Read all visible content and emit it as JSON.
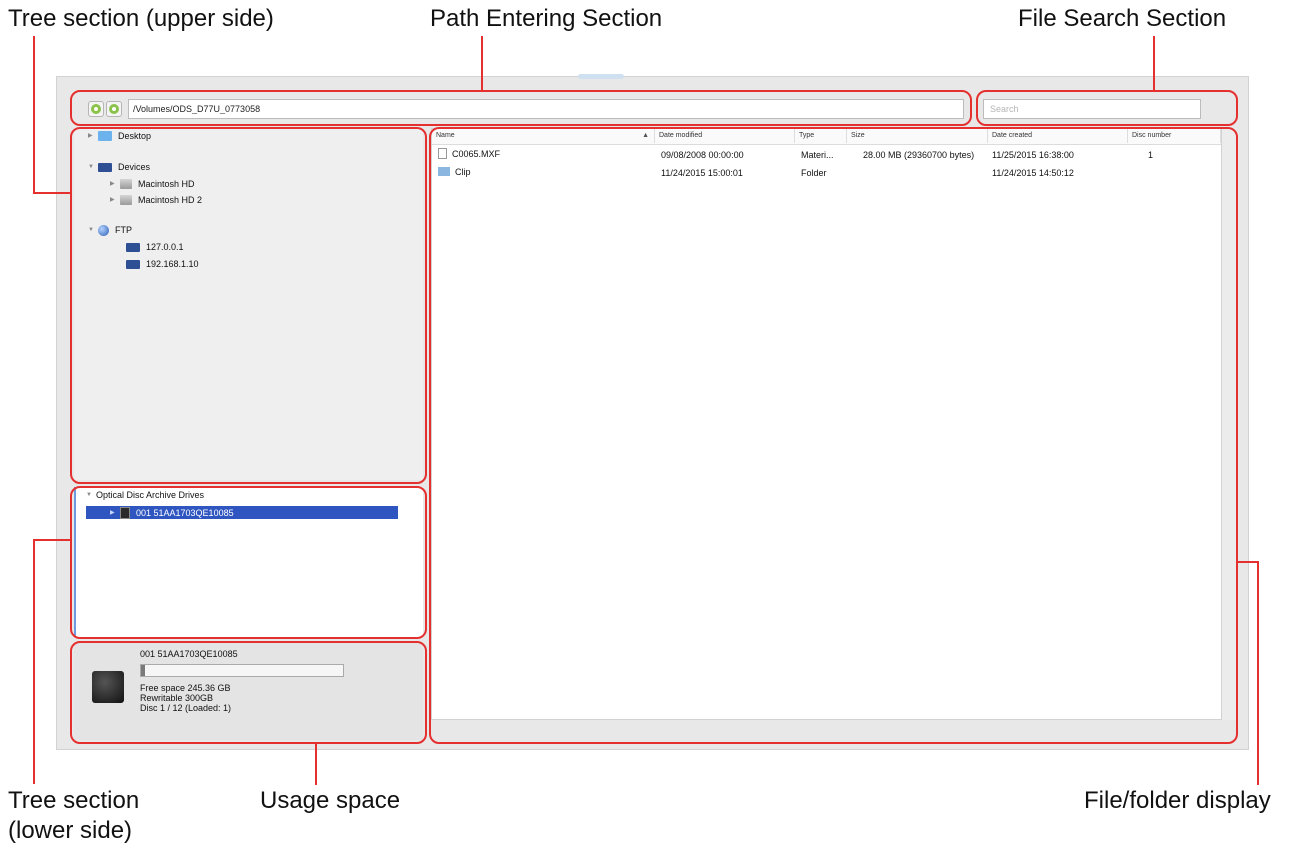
{
  "callouts": {
    "tree_upper": "Tree section (upper side)",
    "path_entering": "Path Entering Section",
    "file_search": "File Search Section",
    "tree_lower_1": "Tree section",
    "tree_lower_2": "(lower side)",
    "usage_space": "Usage space",
    "file_folder_display": "File/folder display"
  },
  "colors": {
    "callout_red": "#e53030",
    "selection_blue": "#2f56c0"
  },
  "toolbar": {
    "path_value": "/Volumes/ODS_D77U_0773058",
    "search_placeholder": "Search"
  },
  "tree_upper": {
    "desktop": "Desktop",
    "devices": "Devices",
    "devices_children": [
      "Macintosh HD",
      "Macintosh HD 2"
    ],
    "ftp": "FTP",
    "ftp_children": [
      "127.0.0.1",
      "192.168.1.10"
    ]
  },
  "tree_lower": {
    "header": "Optical Disc Archive Drives",
    "selected_drive": "001 51AA1703QE10085"
  },
  "table": {
    "columns": [
      "Name",
      "Date modified",
      "Type",
      "Size",
      "Date created",
      "Disc number"
    ],
    "sort_indicator": "▲",
    "rows": [
      {
        "icon": "document-icon",
        "name": "C0065.MXF",
        "modified": "09/08/2008 00:00:00",
        "type": "Materi...",
        "size": "28.00 MB (29360700 bytes)",
        "created": "11/25/2015 16:38:00",
        "disc": "1"
      },
      {
        "icon": "folder-icon",
        "name": "Clip",
        "modified": "11/24/2015 15:00:01",
        "type": "Folder",
        "size": "",
        "created": "11/24/2015 14:50:12",
        "disc": ""
      }
    ]
  },
  "usage": {
    "drive_name": "001 51AA1703QE10085",
    "used_fraction": 0.01,
    "free_space": "Free space 245.36 GB",
    "rewritable": "Rewritable  300GB",
    "disc_info": "Disc 1 / 12 (Loaded: 1)"
  }
}
